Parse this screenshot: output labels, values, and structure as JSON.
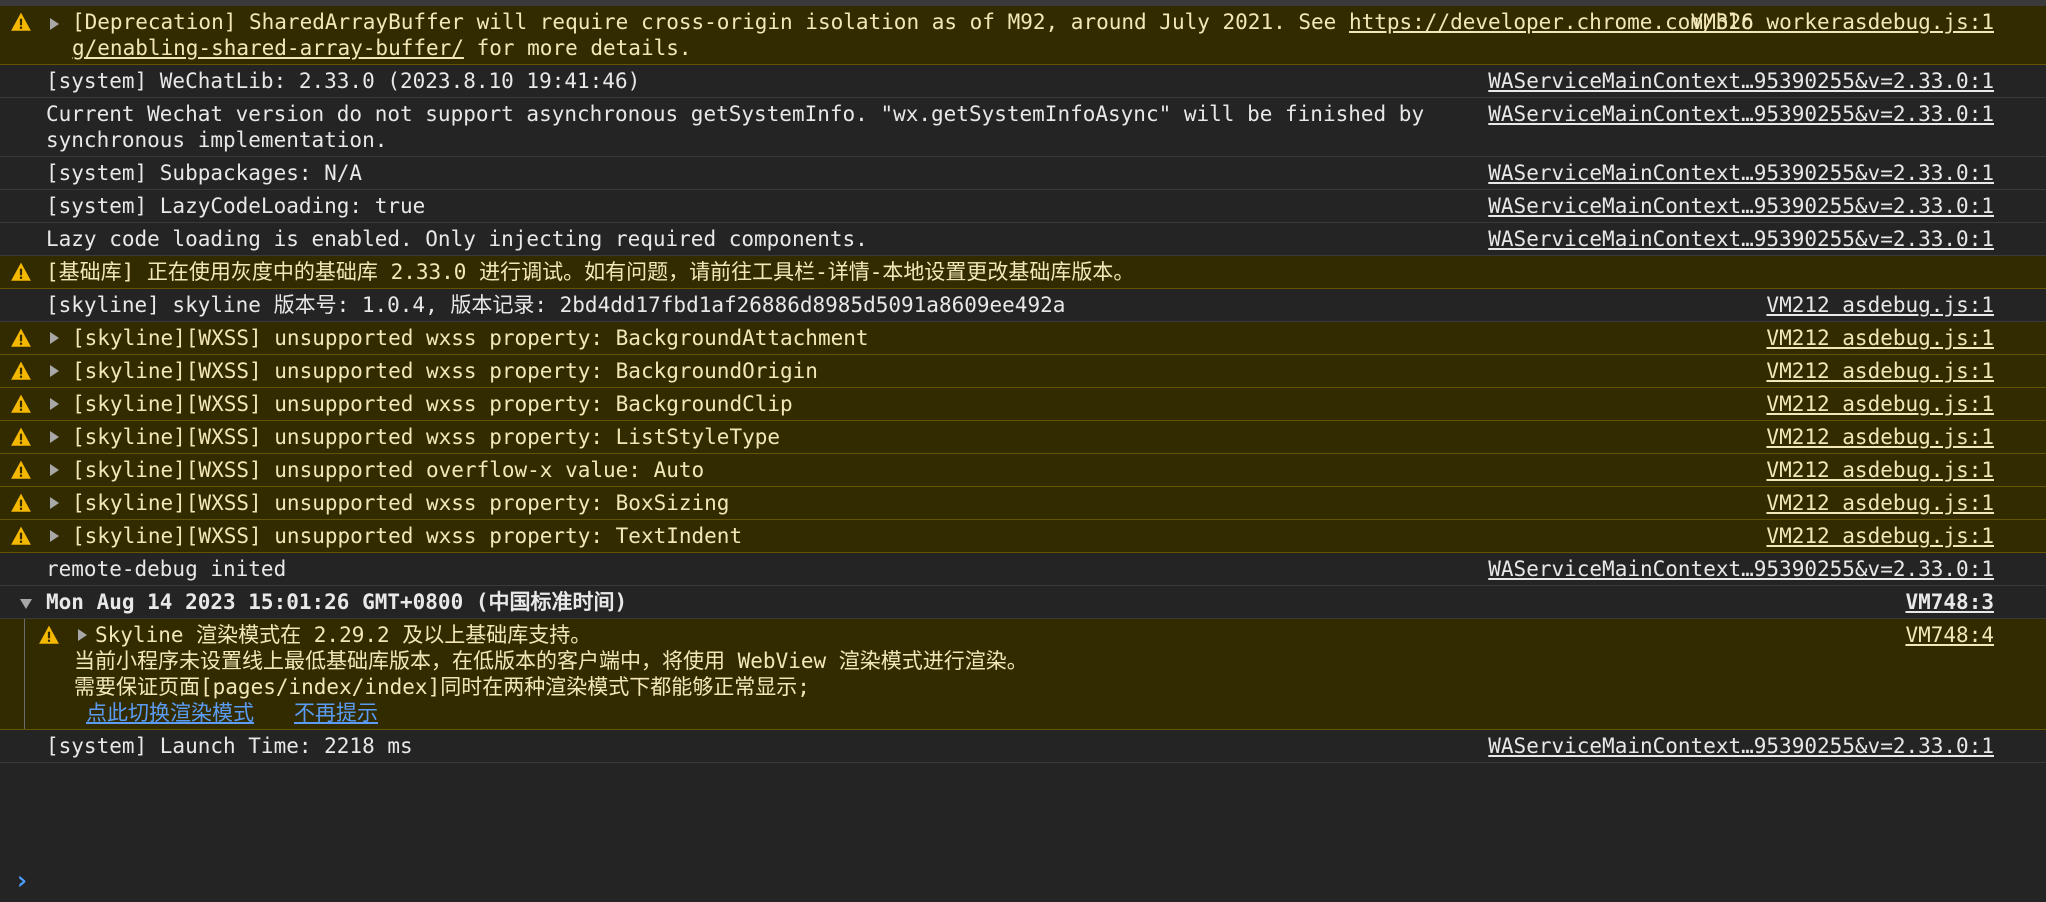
{
  "colors": {
    "warning_bg": "#332b00",
    "warning_icon": "#f5b800",
    "link": "#5a9cf5",
    "prompt": "#4d9cff"
  },
  "rows": [
    {
      "type": "warning",
      "expandable": true,
      "text": "[Deprecation] SharedArrayBuffer will require cross-origin isolation as of M92, around July 2021. See ",
      "link": "https://developer.chrome.com/blog/enabling-shared-array-buffer/",
      "text_after": " for more details.",
      "source": "VM326 workerasdebug.js:1"
    },
    {
      "type": "log",
      "text": "[system] WeChatLib: 2.33.0 (2023.8.10 19:41:46)",
      "source": "WAServiceMainContext…95390255&v=2.33.0:1"
    },
    {
      "type": "log",
      "text": "Current Wechat version do not support asynchronous getSystemInfo. \"wx.getSystemInfoAsync\" will be finished by synchronous implementation.",
      "source": "WAServiceMainContext…95390255&v=2.33.0:1"
    },
    {
      "type": "log",
      "text": "[system] Subpackages: N/A",
      "source": "WAServiceMainContext…95390255&v=2.33.0:1"
    },
    {
      "type": "log",
      "text": "[system] LazyCodeLoading: true",
      "source": "WAServiceMainContext…95390255&v=2.33.0:1"
    },
    {
      "type": "log",
      "text": "Lazy code loading is enabled. Only injecting required components.",
      "source": "WAServiceMainContext…95390255&v=2.33.0:1"
    },
    {
      "type": "warning",
      "text": "[基础库] 正在使用灰度中的基础库 2.33.0 进行调试。如有问题，请前往工具栏-详情-本地设置更改基础库版本。",
      "source": ""
    },
    {
      "type": "log",
      "text": "[skyline] skyline 版本号: 1.0.4, 版本记录: 2bd4dd17fbd1af26886d8985d5091a8609ee492a",
      "source": "VM212 asdebug.js:1"
    },
    {
      "type": "warning",
      "expandable": true,
      "text": "[skyline][WXSS] unsupported wxss property: BackgroundAttachment",
      "source": "VM212 asdebug.js:1"
    },
    {
      "type": "warning",
      "expandable": true,
      "text": "[skyline][WXSS] unsupported wxss property: BackgroundOrigin",
      "source": "VM212 asdebug.js:1"
    },
    {
      "type": "warning",
      "expandable": true,
      "text": "[skyline][WXSS] unsupported wxss property: BackgroundClip",
      "source": "VM212 asdebug.js:1"
    },
    {
      "type": "warning",
      "expandable": true,
      "text": "[skyline][WXSS] unsupported wxss property: ListStyleType",
      "source": "VM212 asdebug.js:1"
    },
    {
      "type": "warning",
      "expandable": true,
      "text": "[skyline][WXSS] unsupported overflow-x value: Auto",
      "source": "VM212 asdebug.js:1"
    },
    {
      "type": "warning",
      "expandable": true,
      "text": "[skyline][WXSS] unsupported wxss property: BoxSizing",
      "source": "VM212 asdebug.js:1"
    },
    {
      "type": "warning",
      "expandable": true,
      "text": "[skyline][WXSS] unsupported wxss property: TextIndent",
      "source": "VM212 asdebug.js:1"
    },
    {
      "type": "log",
      "text": "remote-debug inited",
      "source": "WAServiceMainContext…95390255&v=2.33.0:1"
    }
  ],
  "group": {
    "title": "Mon Aug 14 2023 15:01:26 GMT+0800 (中国标准时间)",
    "source": "VM748:3",
    "warning": {
      "line1": "Skyline 渲染模式在 2.29.2 及以上基础库支持。",
      "line2": "当前小程序未设置线上最低基础库版本，在低版本的客户端中，将使用 WebView 渲染模式进行渲染。",
      "line3": "需要保证页面[pages/index/index]同时在两种渲染模式下都能够正常显示;",
      "link1": "点此切换渲染模式",
      "link2": "不再提示",
      "source": "VM748:4"
    }
  },
  "launch": {
    "text": "[system] Launch Time: 2218 ms",
    "source": "WAServiceMainContext…95390255&v=2.33.0:1"
  },
  "prompt": {
    "icon": "chevron-right-icon",
    "symbol": "›"
  }
}
